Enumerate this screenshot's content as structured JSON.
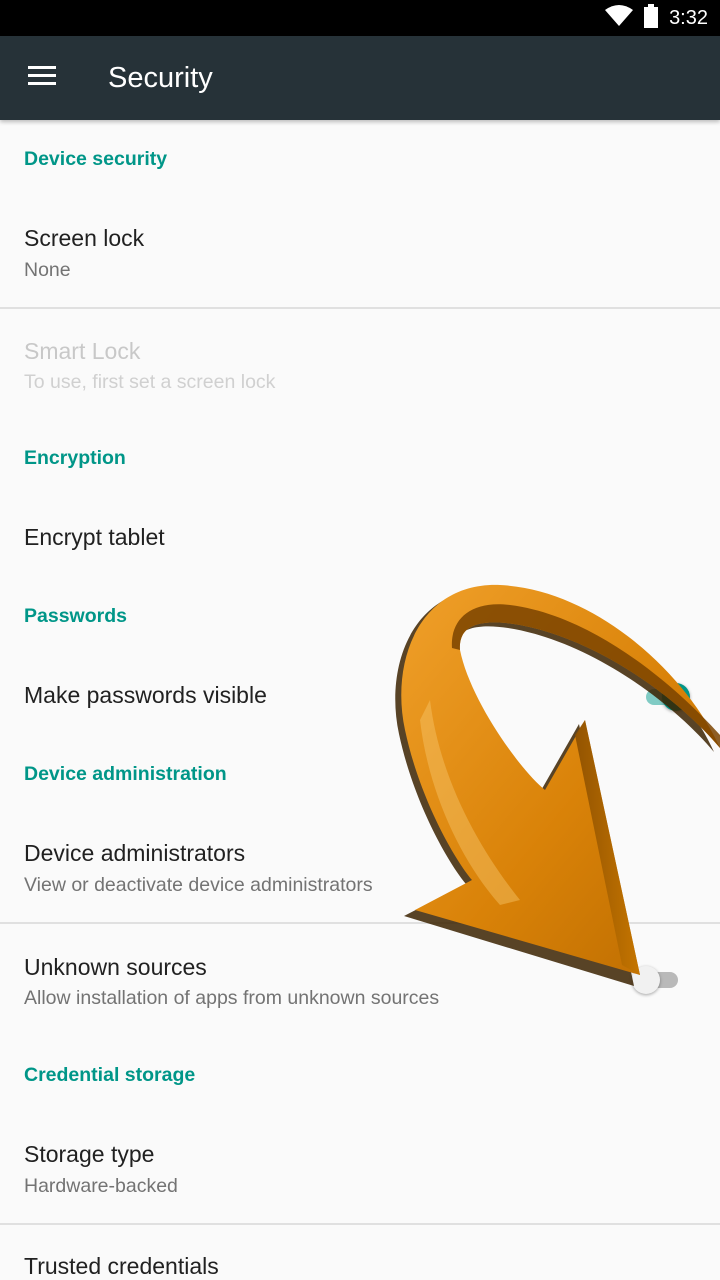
{
  "status_bar": {
    "time": "3:32",
    "icons": [
      "wifi-icon",
      "battery-icon"
    ]
  },
  "app_bar": {
    "title": "Security",
    "menu_icon": "menu-icon"
  },
  "colors": {
    "accent": "#009688",
    "app_bar": "#263238",
    "arrow": "#e08a0b"
  },
  "sections": {
    "device_security": {
      "header": "Device security",
      "screen_lock": {
        "title": "Screen lock",
        "summary": "None"
      },
      "smart_lock": {
        "title": "Smart Lock",
        "summary": "To use, first set a screen lock"
      }
    },
    "encryption": {
      "header": "Encryption",
      "encrypt_tablet": {
        "title": "Encrypt tablet"
      }
    },
    "passwords": {
      "header": "Passwords",
      "make_visible": {
        "title": "Make passwords visible",
        "checked": true
      }
    },
    "device_administration": {
      "header": "Device administration",
      "device_admins": {
        "title": "Device administrators",
        "summary": "View or deactivate device administrators"
      },
      "unknown_sources": {
        "title": "Unknown sources",
        "summary": "Allow installation of apps from unknown sources",
        "checked": false
      }
    },
    "credential_storage": {
      "header": "Credential storage",
      "storage_type": {
        "title": "Storage type",
        "summary": "Hardware-backed"
      },
      "trusted_credentials": {
        "title": "Trusted credentials"
      }
    }
  }
}
